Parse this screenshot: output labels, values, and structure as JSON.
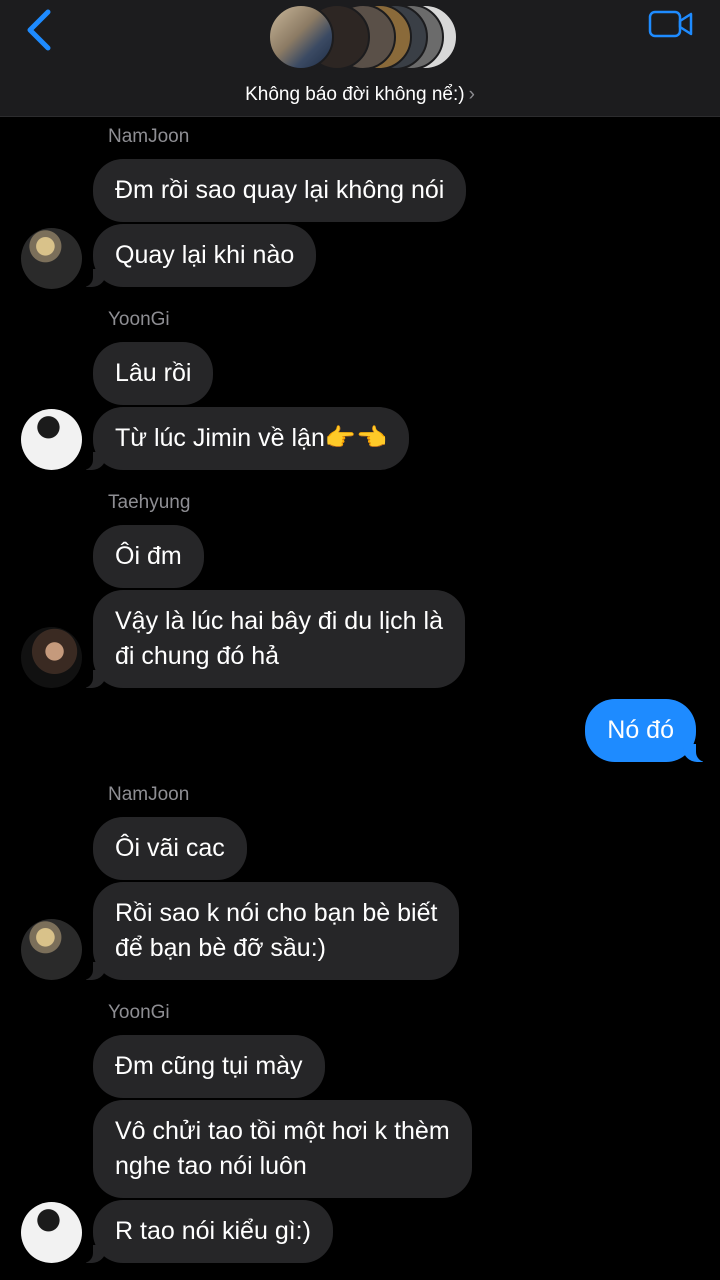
{
  "header": {
    "group_name": "Không báo đời không nể:)",
    "chevron": "›",
    "back_icon": "chevron-left-icon",
    "video_icon": "video-camera-icon",
    "accent_color": "#1e8bff"
  },
  "messages": [
    {
      "sender": "NamJoon",
      "bubbles": [
        "Đm rồi sao quay lại không nói",
        "Quay lại khi nào"
      ]
    },
    {
      "sender": "YoonGi",
      "bubbles": [
        "Lâu rồi",
        "Từ lúc Jimin về lận👉👈"
      ]
    },
    {
      "sender": "Taehyung",
      "bubbles": [
        "Ôi đm",
        "Vậy là lúc hai bây đi du lịch là\nđi chung đó hả"
      ]
    },
    {
      "sender": "me",
      "bubbles": [
        "Nó đó"
      ]
    },
    {
      "sender": "NamJoon",
      "bubbles": [
        "Ôi vãi cac",
        "Rồi sao k nói cho bạn bè biết\nđể bạn bè đỡ sầu:)"
      ]
    },
    {
      "sender": "YoonGi",
      "bubbles": [
        "Đm cũng tụi mày",
        "Vô chửi tao tồi một hơi k thèm\nnghe tao nói luôn",
        "R tao nói kiểu gì:)"
      ]
    }
  ]
}
